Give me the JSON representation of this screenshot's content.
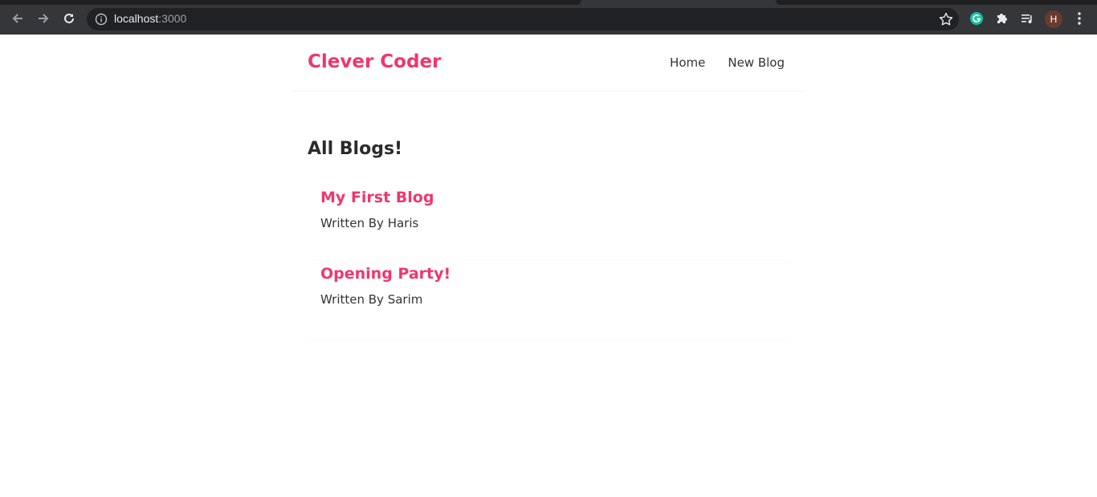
{
  "browser": {
    "url_host": "localhost",
    "url_port": ":3000",
    "profile_initial": "H",
    "icons": {
      "back": "arrow-left-icon",
      "forward": "arrow-right-icon",
      "reload": "reload-icon",
      "info": "info-icon",
      "bookmark": "star-icon",
      "grammarly": "grammarly-icon",
      "extensions": "puzzle-icon",
      "media": "media-queue-icon",
      "menu": "kebab-menu-icon"
    },
    "colors": {
      "chrome": "#35363a",
      "omnibox": "#202124",
      "grammarly": "#15c39a"
    }
  },
  "navbar": {
    "brand": "Clever Coder",
    "links": [
      {
        "label": "Home"
      },
      {
        "label": "New Blog"
      }
    ]
  },
  "main": {
    "heading": "All Blogs!",
    "blogs": [
      {
        "title": "My First Blog",
        "author": "Written By Haris"
      },
      {
        "title": "Opening Party!",
        "author": "Written By Sarim"
      }
    ]
  },
  "colors": {
    "accent": "#f1356d",
    "text": "#333333"
  }
}
